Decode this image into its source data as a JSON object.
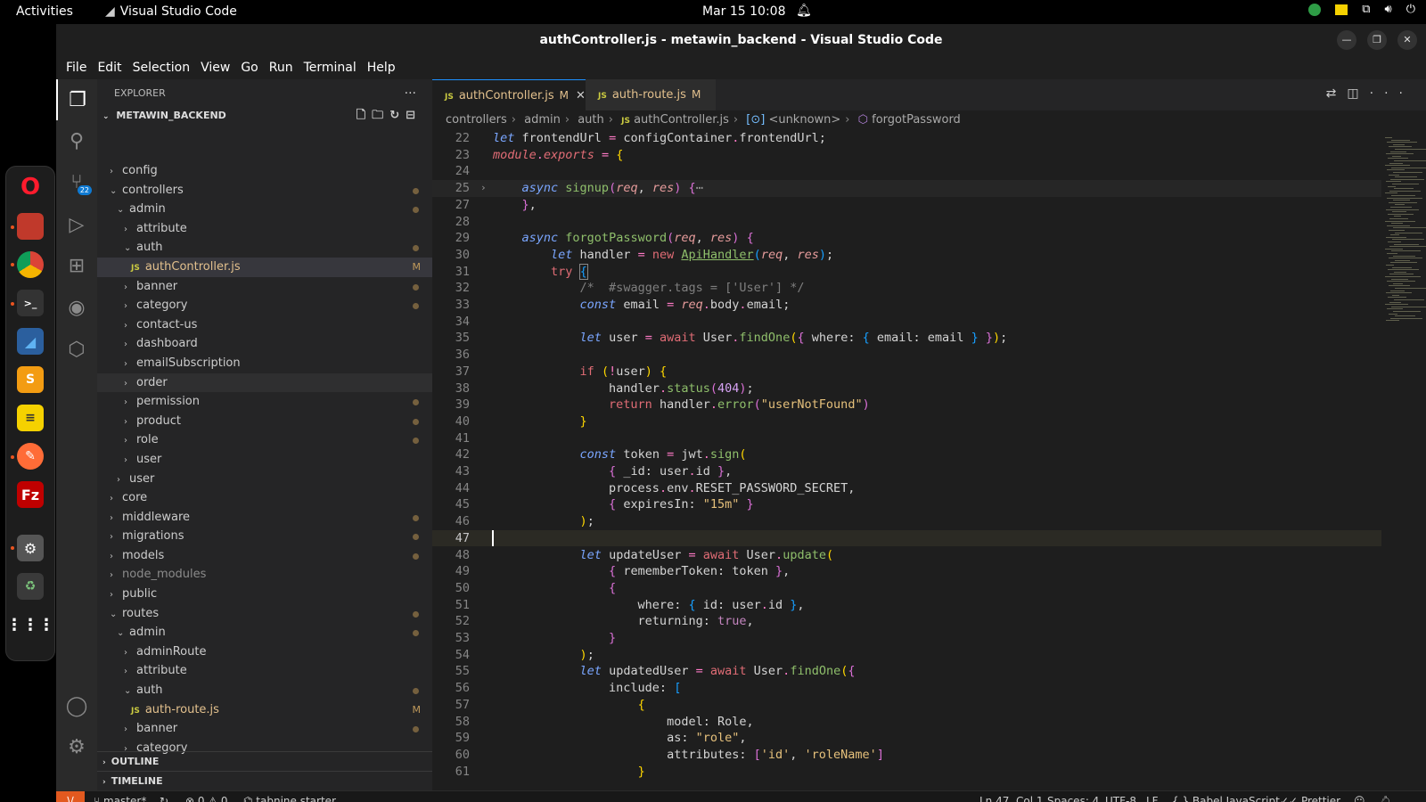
{
  "topbar": {
    "activities": "Activities",
    "app_name": "Visual Studio Code",
    "clock": "Mar 15  10:08"
  },
  "window": {
    "title": "authController.js - metawin_backend - Visual Studio Code"
  },
  "menu": [
    "File",
    "Edit",
    "Selection",
    "View",
    "Go",
    "Run",
    "Terminal",
    "Help"
  ],
  "activity": {
    "scm_badge": "22"
  },
  "explorer": {
    "header": "EXPLORER",
    "root": "METAWIN_BACKEND",
    "tree": [
      {
        "label": "config",
        "depth": 1,
        "kind": "closed"
      },
      {
        "label": "controllers",
        "depth": 1,
        "kind": "open",
        "dot": true
      },
      {
        "label": "admin",
        "depth": 2,
        "kind": "open",
        "dot": true
      },
      {
        "label": "attribute",
        "depth": 3,
        "kind": "closed"
      },
      {
        "label": "auth",
        "depth": 3,
        "kind": "open",
        "dot": true
      },
      {
        "label": "authController.js",
        "depth": 4,
        "kind": "file",
        "mod": "M",
        "selected": true
      },
      {
        "label": "banner",
        "depth": 3,
        "kind": "closed",
        "dot": true
      },
      {
        "label": "category",
        "depth": 3,
        "kind": "closed",
        "dot": true
      },
      {
        "label": "contact-us",
        "depth": 3,
        "kind": "closed"
      },
      {
        "label": "dashboard",
        "depth": 3,
        "kind": "closed"
      },
      {
        "label": "emailSubscription",
        "depth": 3,
        "kind": "closed"
      },
      {
        "label": "order",
        "depth": 3,
        "kind": "closed",
        "hover": true
      },
      {
        "label": "permission",
        "depth": 3,
        "kind": "closed",
        "dot": true
      },
      {
        "label": "product",
        "depth": 3,
        "kind": "closed",
        "dot": true
      },
      {
        "label": "role",
        "depth": 3,
        "kind": "closed",
        "dot": true
      },
      {
        "label": "user",
        "depth": 3,
        "kind": "closed"
      },
      {
        "label": "user",
        "depth": 2,
        "kind": "closed"
      },
      {
        "label": "core",
        "depth": 1,
        "kind": "closed"
      },
      {
        "label": "middleware",
        "depth": 1,
        "kind": "closed",
        "dot": true
      },
      {
        "label": "migrations",
        "depth": 1,
        "kind": "closed",
        "dot": true
      },
      {
        "label": "models",
        "depth": 1,
        "kind": "closed",
        "dot": true
      },
      {
        "label": "node_modules",
        "depth": 1,
        "kind": "closed",
        "dim": true
      },
      {
        "label": "public",
        "depth": 1,
        "kind": "closed"
      },
      {
        "label": "routes",
        "depth": 1,
        "kind": "open",
        "dot": true
      },
      {
        "label": "admin",
        "depth": 2,
        "kind": "open",
        "dot": true
      },
      {
        "label": "adminRoute",
        "depth": 3,
        "kind": "closed"
      },
      {
        "label": "attribute",
        "depth": 3,
        "kind": "closed"
      },
      {
        "label": "auth",
        "depth": 3,
        "kind": "open",
        "dot": true
      },
      {
        "label": "auth-route.js",
        "depth": 4,
        "kind": "file",
        "mod": "M"
      },
      {
        "label": "banner",
        "depth": 3,
        "kind": "closed",
        "dot": true
      },
      {
        "label": "category",
        "depth": 3,
        "kind": "closed"
      }
    ],
    "outline": "OUTLINE",
    "timeline": "TIMELINE"
  },
  "tabs": [
    {
      "label": "authController.js",
      "mod": "M",
      "active": true
    },
    {
      "label": "auth-route.js",
      "mod": "M",
      "active": false
    }
  ],
  "breadcrumb": [
    "controllers",
    "admin",
    "auth",
    "authController.js",
    "<unknown>",
    "forgotPassword"
  ],
  "code": {
    "current_line": 47,
    "lines": [
      {
        "n": "22",
        "html": "<span class=\"it\">let</span> frontendUrl <span class=\"pk\">=</span> configContainer<span class=\"pk\">.</span>frontendUrl;"
      },
      {
        "n": "23",
        "html": "<span class=\"kw\" style=\"font-style:italic\">module</span><span class=\"pk\">.</span><span class=\"kw\" style=\"font-style:italic\">exports</span> <span class=\"pk\">=</span> <span class=\"br1\">{</span>"
      },
      {
        "n": "24",
        "html": ""
      },
      {
        "n": "25",
        "html": "    <span class=\"it\">async</span> <span class=\"gr\">signup</span><span class=\"br2\">(</span><span class=\"pm\">req</span>, <span class=\"pm\">res</span><span class=\"br2\">)</span> <span class=\"br2\">{</span><span style=\"color:#999\">⋯</span>",
        "fold": true
      },
      {
        "n": "27",
        "html": "    <span class=\"br2\">}</span>,"
      },
      {
        "n": "28",
        "html": ""
      },
      {
        "n": "29",
        "html": "    <span class=\"it\">async</span> <span class=\"gr\">forgotPassword</span><span class=\"br2\">(</span><span class=\"pm\">req</span>, <span class=\"pm\">res</span><span class=\"br2\">)</span> <span class=\"br2\">{</span>"
      },
      {
        "n": "30",
        "html": "        <span class=\"it\">let</span> handler <span class=\"pk\">=</span> <span class=\"kw\">new</span> <span class=\"gr\" style=\"text-decoration:underline\">ApiHandler</span><span class=\"br3\">(</span><span class=\"pm\">req</span>, <span class=\"pm\">res</span><span class=\"br3\">)</span>;"
      },
      {
        "n": "31",
        "html": "        <span class=\"kw\">try</span> <span class=\"br3\" style=\"outline:1px solid #888\">{</span>"
      },
      {
        "n": "32",
        "html": "            <span class=\"cm\" style=\"color:#7f7f7f\">/*  #swagger.tags = ['User'] */</span>"
      },
      {
        "n": "33",
        "html": "            <span class=\"it\">const</span> email <span class=\"pk\">=</span> <span class=\"pm\">req</span><span class=\"pk\">.</span>body<span class=\"pk\">.</span>email;"
      },
      {
        "n": "34",
        "html": ""
      },
      {
        "n": "35",
        "html": "            <span class=\"it\">let</span> user <span class=\"pk\">=</span> <span class=\"kw\">await</span> User<span class=\"pk\">.</span><span class=\"gr\">findOne</span><span class=\"br1\">(</span><span class=\"br2\">{</span> where: <span class=\"br3\">{</span> email: email <span class=\"br3\">}</span> <span class=\"br2\">}</span><span class=\"br1\">)</span>;"
      },
      {
        "n": "36",
        "html": ""
      },
      {
        "n": "37",
        "html": "            <span class=\"kw\">if</span> <span class=\"br1\">(</span><span class=\"pk\">!</span>user<span class=\"br1\">)</span> <span class=\"br1\">{</span>"
      },
      {
        "n": "38",
        "html": "                handler<span class=\"pk\">.</span><span class=\"gr\">status</span><span class=\"br2\">(</span><span class=\"num\" style=\"color:#d7a3f5\">404</span><span class=\"br2\">)</span>;"
      },
      {
        "n": "39",
        "html": "                <span class=\"kw\">return</span> handler<span class=\"pk\">.</span><span class=\"gr\">error</span><span class=\"br2\">(</span><span class=\"fn2\">\"userNotFound\"</span><span class=\"br2\">)</span>"
      },
      {
        "n": "40",
        "html": "            <span class=\"br1\">}</span>"
      },
      {
        "n": "41",
        "html": ""
      },
      {
        "n": "42",
        "html": "            <span class=\"it\">const</span> token <span class=\"pk\">=</span> jwt<span class=\"pk\">.</span><span class=\"gr\">sign</span><span class=\"br1\">(</span>"
      },
      {
        "n": "43",
        "html": "                <span class=\"br2\">{</span> _id: user<span class=\"pk\">.</span>id <span class=\"br2\">}</span>,"
      },
      {
        "n": "44",
        "html": "                process<span class=\"pk\">.</span>env<span class=\"pk\">.</span>RESET_PASSWORD_SECRET,"
      },
      {
        "n": "45",
        "html": "                <span class=\"br2\">{</span> expiresIn: <span class=\"fn2\">\"15m\"</span> <span class=\"br2\">}</span>"
      },
      {
        "n": "46",
        "html": "            <span class=\"br1\">)</span>;"
      },
      {
        "n": "47",
        "html": "",
        "current": true
      },
      {
        "n": "48",
        "html": "            <span class=\"it\">let</span> updateUser <span class=\"pk\">=</span> <span class=\"kw\">await</span> User<span class=\"pk\">.</span><span class=\"gr\">update</span><span class=\"br1\">(</span>"
      },
      {
        "n": "49",
        "html": "                <span class=\"br2\">{</span> rememberToken: token <span class=\"br2\">}</span>,"
      },
      {
        "n": "50",
        "html": "                <span class=\"br2\">{</span>"
      },
      {
        "n": "51",
        "html": "                    where: <span class=\"br3\">{</span> id: user<span class=\"pk\">.</span>id <span class=\"br3\">}</span>,"
      },
      {
        "n": "52",
        "html": "                    returning: <span class=\"k\">true</span>,"
      },
      {
        "n": "53",
        "html": "                <span class=\"br2\">}</span>"
      },
      {
        "n": "54",
        "html": "            <span class=\"br1\">)</span>;"
      },
      {
        "n": "55",
        "html": "            <span class=\"it\">let</span> updatedUser <span class=\"pk\">=</span> <span class=\"kw\">await</span> User<span class=\"pk\">.</span><span class=\"gr\">findOne</span><span class=\"br1\">(</span><span class=\"br2\">{</span>"
      },
      {
        "n": "56",
        "html": "                include: <span class=\"br3\">[</span>"
      },
      {
        "n": "57",
        "html": "                    <span class=\"br1\">{</span>"
      },
      {
        "n": "58",
        "html": "                        model: Role,"
      },
      {
        "n": "59",
        "html": "                        as: <span class=\"fn2\">\"role\"</span>,"
      },
      {
        "n": "60",
        "html": "                        attributes: <span class=\"br2\">[</span><span class=\"fn2\">'id'</span>, <span class=\"fn2\">'roleName'</span><span class=\"br2\">]</span>"
      },
      {
        "n": "61",
        "html": "                    <span class=\"br1\">}</span>"
      }
    ]
  },
  "status": {
    "branch": "master*",
    "errors": "0",
    "warnings": "0",
    "tabnine": "tabnine starter",
    "position": "Ln 47, Col 1",
    "spaces": "Spaces: 4",
    "encoding": "UTF-8",
    "eol": "LF",
    "language": "Babel JavaScript",
    "prettier": "Prettier"
  },
  "colors": {
    "accent": "#1e90ff",
    "remote": "#e2591f",
    "modified": "#e2c08d"
  }
}
